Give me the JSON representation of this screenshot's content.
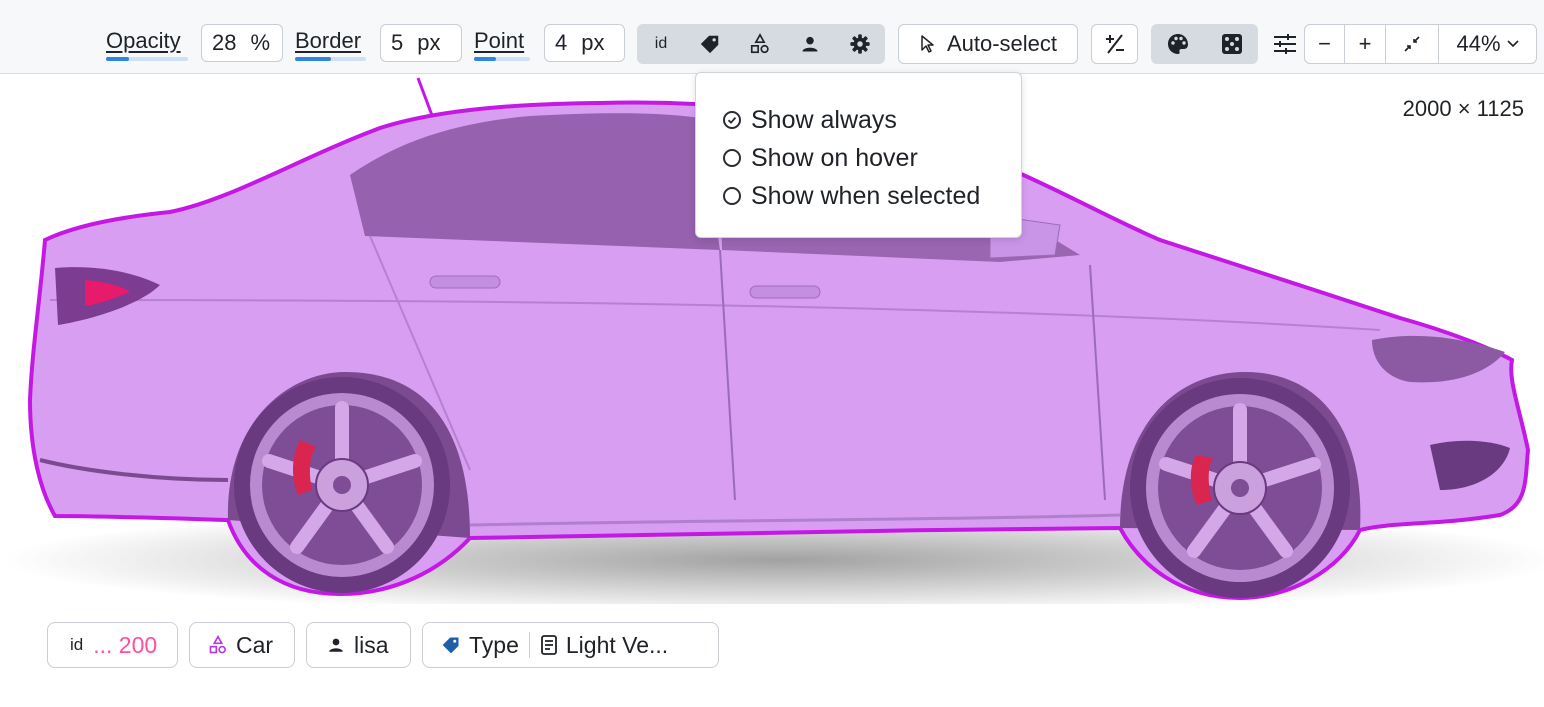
{
  "toolbar": {
    "opacity": {
      "label": "Opacity",
      "value": "28",
      "unit": "%",
      "level": 0.28
    },
    "border": {
      "label": "Border",
      "value": "5",
      "unit": "px",
      "level": 0.5
    },
    "point": {
      "label": "Point",
      "value": "4",
      "unit": "px",
      "level": 0.4
    },
    "label_toggles": {
      "id_label": "id",
      "icons": [
        "tag-icon",
        "shapes-icon",
        "user-icon",
        "gear-icon"
      ]
    },
    "auto_select": {
      "label": "Auto-select",
      "icon": "cursor-icon"
    },
    "plus_minus_icon": "plus-minus-icon",
    "color_icons": [
      "palette-icon",
      "dice-icon"
    ],
    "adjust_icon": "sliders-icon",
    "zoom": {
      "minus": "−",
      "plus": "+",
      "fit_icon": "fit-icon",
      "level": "44%"
    }
  },
  "canvas": {
    "image_dimensions": "2000 × 1125",
    "mask_color": "#d79ef2",
    "outline_color": "#c418e4"
  },
  "label_menu": {
    "options": [
      "Show always",
      "Show on hover",
      "Show when selected"
    ],
    "selected": "Show always"
  },
  "chips": {
    "id_label": "id",
    "id_value": "... 200",
    "class_name": "Car",
    "user": "lisa",
    "attribute_name": "Type",
    "attribute_value": "Light Ve..."
  },
  "colors": {
    "accent": "#2f86e0",
    "id_pink": "#ff4fa0",
    "class_purple": "#b33be0",
    "tag_blue": "#1f5fa8"
  }
}
